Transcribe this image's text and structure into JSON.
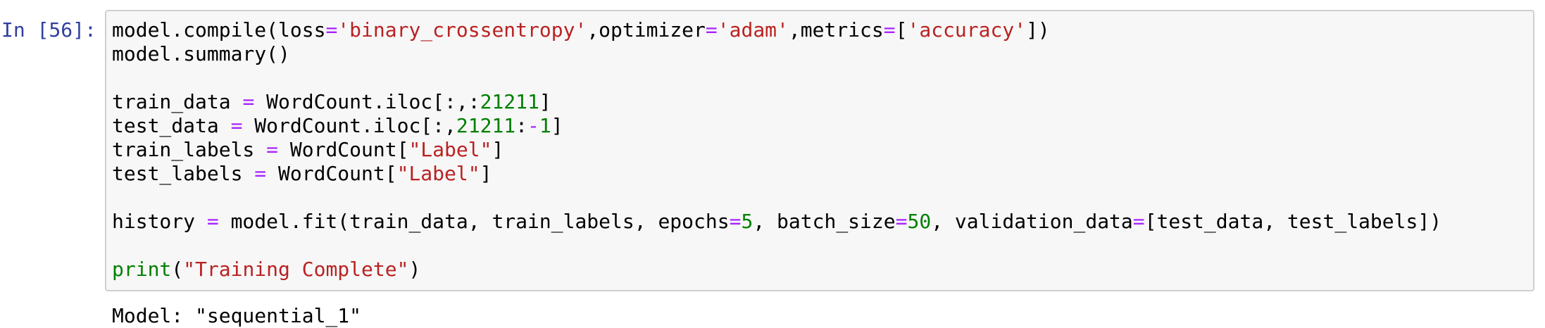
{
  "cell": {
    "prompt": "In [56]:",
    "code_lines": [
      [
        {
          "t": "model.compile(loss",
          "c": "plain"
        },
        {
          "t": "=",
          "c": "op"
        },
        {
          "t": "'binary_crossentropy'",
          "c": "str"
        },
        {
          "t": ",optimizer",
          "c": "plain"
        },
        {
          "t": "=",
          "c": "op"
        },
        {
          "t": "'adam'",
          "c": "str"
        },
        {
          "t": ",metrics",
          "c": "plain"
        },
        {
          "t": "=",
          "c": "op"
        },
        {
          "t": "[",
          "c": "plain"
        },
        {
          "t": "'accuracy'",
          "c": "str"
        },
        {
          "t": "])",
          "c": "plain"
        }
      ],
      [
        {
          "t": "model.summary()",
          "c": "plain"
        }
      ],
      [],
      [
        {
          "t": "train_data ",
          "c": "plain"
        },
        {
          "t": "=",
          "c": "op"
        },
        {
          "t": " WordCount.iloc[:,:",
          "c": "plain"
        },
        {
          "t": "21211",
          "c": "num"
        },
        {
          "t": "]",
          "c": "plain"
        }
      ],
      [
        {
          "t": "test_data ",
          "c": "plain"
        },
        {
          "t": "=",
          "c": "op"
        },
        {
          "t": " WordCount.iloc[:,",
          "c": "plain"
        },
        {
          "t": "21211",
          "c": "num"
        },
        {
          "t": ":",
          "c": "plain"
        },
        {
          "t": "-",
          "c": "op"
        },
        {
          "t": "1",
          "c": "num"
        },
        {
          "t": "]",
          "c": "plain"
        }
      ],
      [
        {
          "t": "train_labels ",
          "c": "plain"
        },
        {
          "t": "=",
          "c": "op"
        },
        {
          "t": " WordCount[",
          "c": "plain"
        },
        {
          "t": "\"Label\"",
          "c": "str"
        },
        {
          "t": "]",
          "c": "plain"
        }
      ],
      [
        {
          "t": "test_labels ",
          "c": "plain"
        },
        {
          "t": "=",
          "c": "op"
        },
        {
          "t": " WordCount[",
          "c": "plain"
        },
        {
          "t": "\"Label\"",
          "c": "str"
        },
        {
          "t": "]",
          "c": "plain"
        }
      ],
      [],
      [
        {
          "t": "history ",
          "c": "plain"
        },
        {
          "t": "=",
          "c": "op"
        },
        {
          "t": " model.fit(train_data, train_labels, epochs",
          "c": "plain"
        },
        {
          "t": "=",
          "c": "op"
        },
        {
          "t": "5",
          "c": "num"
        },
        {
          "t": ", batch_size",
          "c": "plain"
        },
        {
          "t": "=",
          "c": "op"
        },
        {
          "t": "50",
          "c": "num"
        },
        {
          "t": ", validation_data",
          "c": "plain"
        },
        {
          "t": "=",
          "c": "op"
        },
        {
          "t": "[test_data, test_labels])",
          "c": "plain"
        }
      ],
      [],
      [
        {
          "t": "print",
          "c": "builtin"
        },
        {
          "t": "(",
          "c": "plain"
        },
        {
          "t": "\"Training Complete\"",
          "c": "str"
        },
        {
          "t": ")",
          "c": "plain"
        }
      ]
    ],
    "output_text": "Model: \"sequential_1\""
  },
  "colors": {
    "prompt": "#303f9f",
    "string": "#ba2121",
    "number": "#008000",
    "operator": "#aa22ff",
    "builtin": "#008000",
    "cell_background": "#f7f7f7",
    "cell_border": "#cfcfcf"
  }
}
